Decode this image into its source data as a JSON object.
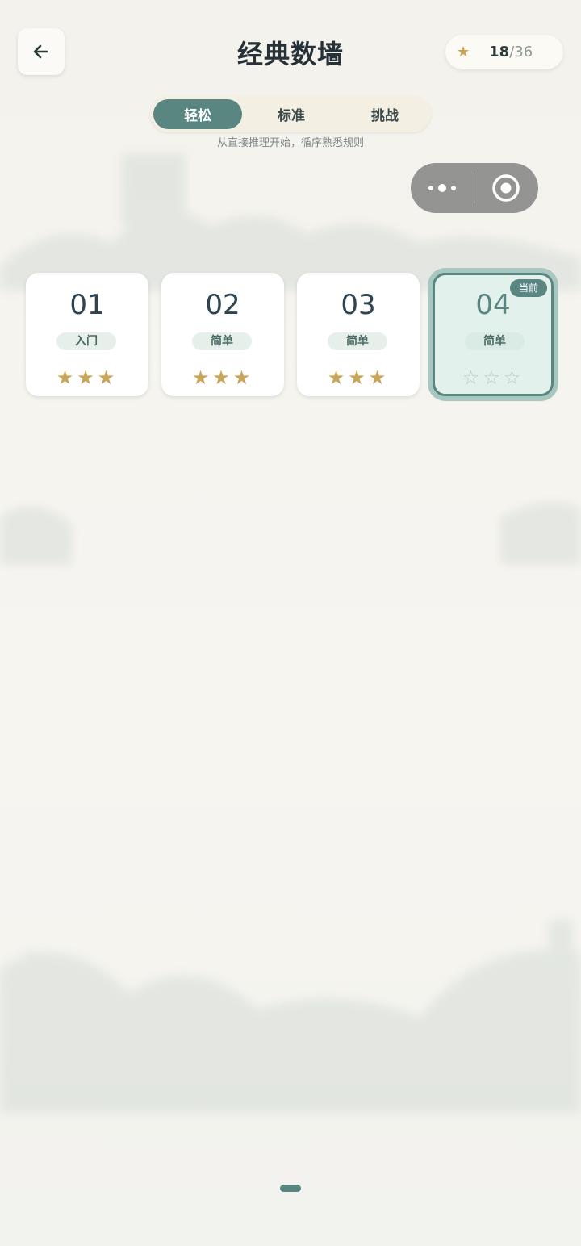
{
  "header": {
    "title": "经典数墙",
    "stars_earned": "18",
    "stars_sep": "/",
    "stars_total": "36"
  },
  "tabs": [
    {
      "label": "轻松",
      "active": true
    },
    {
      "label": "标准",
      "active": false
    },
    {
      "label": "挑战",
      "active": false
    }
  ],
  "tab_description": "从直接推理开始，循序熟悉规则",
  "levels": [
    {
      "number": "01",
      "difficulty": "入门",
      "stars": "★★★",
      "stars_earned": 3
    },
    {
      "number": "02",
      "difficulty": "简单",
      "stars": "★★★",
      "stars_earned": 3
    },
    {
      "number": "03",
      "difficulty": "简单",
      "stars": "★★★",
      "stars_earned": 3
    },
    {
      "number": "04",
      "difficulty": "简单",
      "stars": "☆☆☆",
      "stars_earned": 0,
      "badge": "当前"
    }
  ],
  "icons": {
    "back": "arrow-left-icon",
    "star": "star-icon",
    "more": "more-dots-icon",
    "close": "target-circle-icon"
  },
  "colors": {
    "accent": "#5a8681",
    "star_gold": "#c9a557",
    "star_empty": "#bfc7c4"
  }
}
